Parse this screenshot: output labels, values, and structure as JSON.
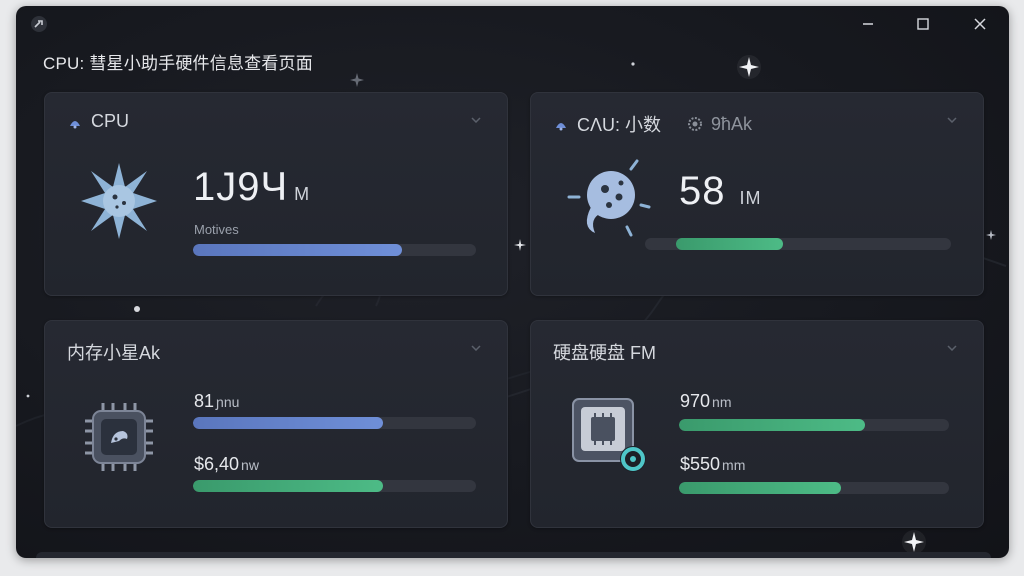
{
  "window": {
    "title": "CPU: 彗星小助手硬件信息查看页面",
    "controls": {
      "minimize": "—",
      "maximize": "☐",
      "close": "✕"
    }
  },
  "cards": {
    "cpu": {
      "header": "CPU",
      "value": "1Ј9Ч",
      "unit": "M",
      "sublabel": "Motives",
      "progress": 0.74,
      "icon": "spiky-star-icon"
    },
    "cpu2": {
      "header": "CΛU: 小数",
      "header2": "9ħAk",
      "value": "58",
      "unit": "IM",
      "progress": 0.35,
      "icon": "comet-planet-icon"
    },
    "memory": {
      "header": "内存小星Ak",
      "stat1_value": "81",
      "stat1_unit": "ɲnu",
      "stat1_progress": 0.67,
      "stat2_value": "$6,40",
      "stat2_unit": "nw",
      "stat2_progress": 0.67,
      "icon": "chip-icon"
    },
    "disk": {
      "header": "硬盘硬盘 FM",
      "stat1_value": "970",
      "stat1_unit": "nm",
      "stat1_progress": 0.69,
      "stat2_value": "$550",
      "stat2_unit": "mm",
      "stat2_progress": 0.6,
      "icon": "disk-chip-icon"
    }
  },
  "colors": {
    "accent_blue": "#6f8fd8",
    "accent_green": "#4dbb86",
    "background": "#17191f",
    "card": "#242730"
  }
}
